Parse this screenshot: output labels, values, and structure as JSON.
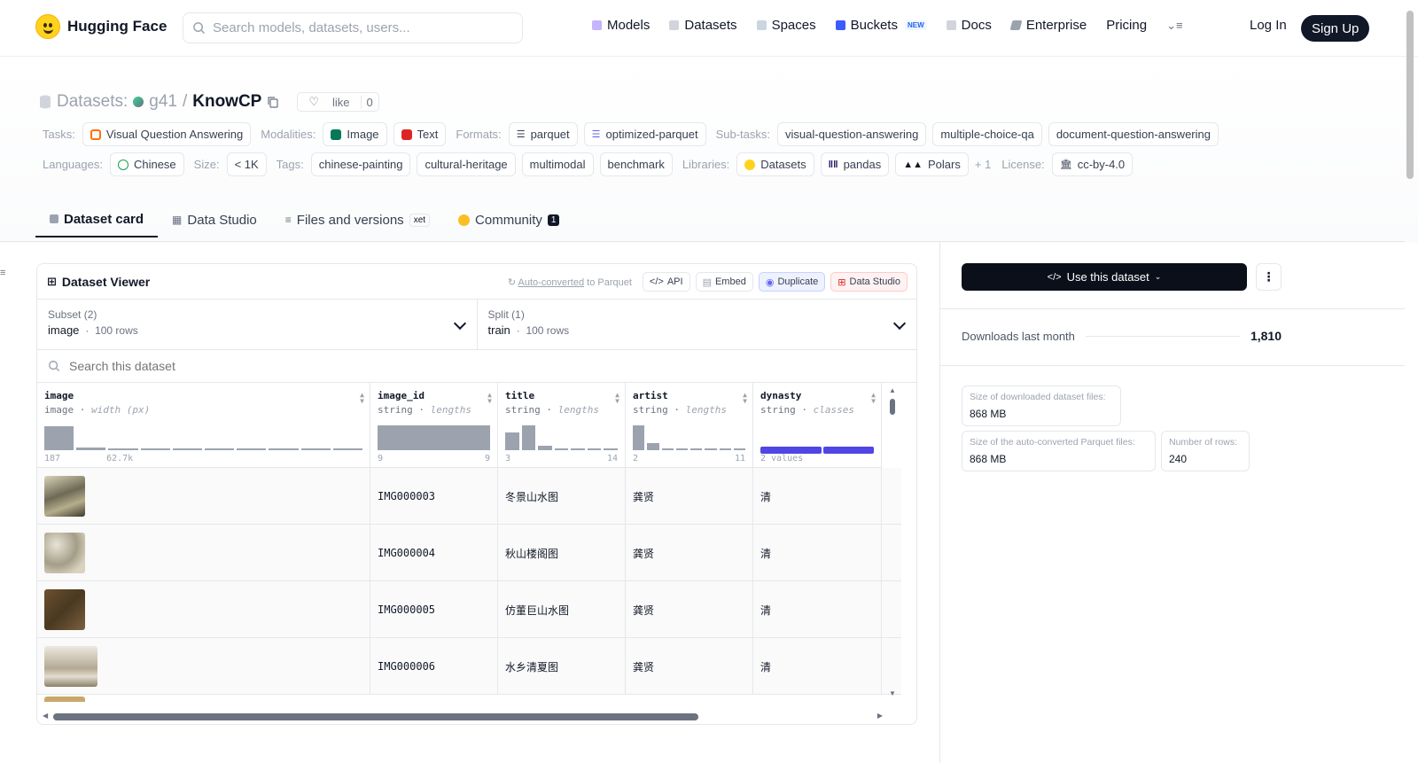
{
  "nav": {
    "brand": "Hugging Face",
    "search_placeholder": "Search models, datasets, users...",
    "links": [
      "Models",
      "Datasets",
      "Spaces",
      "Buckets",
      "Docs",
      "Enterprise",
      "Pricing"
    ],
    "new_badge": "NEW",
    "login": "Log In",
    "signup": "Sign Up"
  },
  "repo": {
    "section_label": "Datasets:",
    "owner": "g41",
    "separator": "/",
    "name": "KnowCP",
    "like_label": "like",
    "like_count": "0"
  },
  "meta": {
    "tasks_label": "Tasks:",
    "tasks": [
      "Visual Question Answering"
    ],
    "modalities_label": "Modalities:",
    "modalities": [
      "Image",
      "Text"
    ],
    "formats_label": "Formats:",
    "formats": [
      "parquet",
      "optimized-parquet"
    ],
    "subtasks_label": "Sub-tasks:",
    "subtasks": [
      "visual-question-answering",
      "multiple-choice-qa",
      "document-question-answering"
    ],
    "languages_label": "Languages:",
    "languages": [
      "Chinese"
    ],
    "size_label": "Size:",
    "size": "< 1K",
    "tags_label": "Tags:",
    "tags": [
      "chinese-painting",
      "cultural-heritage",
      "multimodal",
      "benchmark"
    ],
    "libraries_label": "Libraries:",
    "libraries": [
      "Datasets",
      "pandas",
      "Polars"
    ],
    "libraries_more": "+ 1",
    "license_label": "License:",
    "license": "cc-by-4.0"
  },
  "tabs": {
    "card": "Dataset card",
    "studio": "Data Studio",
    "files": "Files and versions",
    "files_badge": "xet",
    "community": "Community",
    "community_count": "1"
  },
  "viewer": {
    "title": "Dataset Viewer",
    "auto_link": "Auto-converted",
    "auto_rest": " to Parquet",
    "api": "API",
    "embed": "Embed",
    "duplicate": "Duplicate",
    "data_studio": "Data Studio",
    "subset_label": "Subset (2)",
    "subset_value": "image",
    "subset_rows": "100 rows",
    "split_label": "Split (1)",
    "split_value": "train",
    "split_rows": "100 rows",
    "dot": "·",
    "search_placeholder": "Search this dataset",
    "columns": [
      {
        "name": "image",
        "type": "image",
        "stat": "width (px)",
        "min": "187",
        "max": "62.7k",
        "hist": [
          0.95,
          0.1,
          0.08,
          0.02,
          0.05,
          0.02,
          0.02,
          0.06,
          0.02,
          0.05
        ]
      },
      {
        "name": "image_id",
        "type": "string",
        "stat": "lengths",
        "min": "9",
        "max": "9",
        "hist": [
          1.0
        ]
      },
      {
        "name": "title",
        "type": "string",
        "stat": "lengths",
        "min": "3",
        "max": "14",
        "hist": [
          0.7,
          1.0,
          0.18,
          0.05,
          0.05,
          0.05,
          0.05
        ]
      },
      {
        "name": "artist",
        "type": "string",
        "stat": "lengths",
        "min": "2",
        "max": "11",
        "hist": [
          1.0,
          0.3,
          0.05,
          0.05,
          0.08,
          0.05,
          0.05,
          0.05
        ]
      },
      {
        "name": "dynasty",
        "type": "string",
        "stat": "classes",
        "classes": "2 values",
        "class_split": [
          0.55,
          0.45
        ]
      }
    ],
    "rows": [
      {
        "image_id": "IMG000003",
        "title": "冬景山水图",
        "artist": "龚贤",
        "dynasty": "清"
      },
      {
        "image_id": "IMG000004",
        "title": "秋山楼阁图",
        "artist": "龚贤",
        "dynasty": "清"
      },
      {
        "image_id": "IMG000005",
        "title": "仿董巨山水图",
        "artist": "龚贤",
        "dynasty": "清"
      },
      {
        "image_id": "IMG000006",
        "title": "水乡清夏图",
        "artist": "龚贤",
        "dynasty": "清"
      }
    ]
  },
  "sidebar": {
    "use_button": "Use this dataset",
    "downloads_label": "Downloads last month",
    "downloads_value": "1,810",
    "stats": [
      {
        "label": "Size of downloaded dataset files:",
        "value": "868 MB"
      },
      {
        "label": "Size of the auto-converted Parquet files:",
        "value": "868 MB"
      },
      {
        "label": "Number of rows:",
        "value": "240"
      }
    ]
  },
  "colors": {
    "accent": "#4f46e5",
    "dark": "#111827",
    "brand": "#ffd21e"
  }
}
